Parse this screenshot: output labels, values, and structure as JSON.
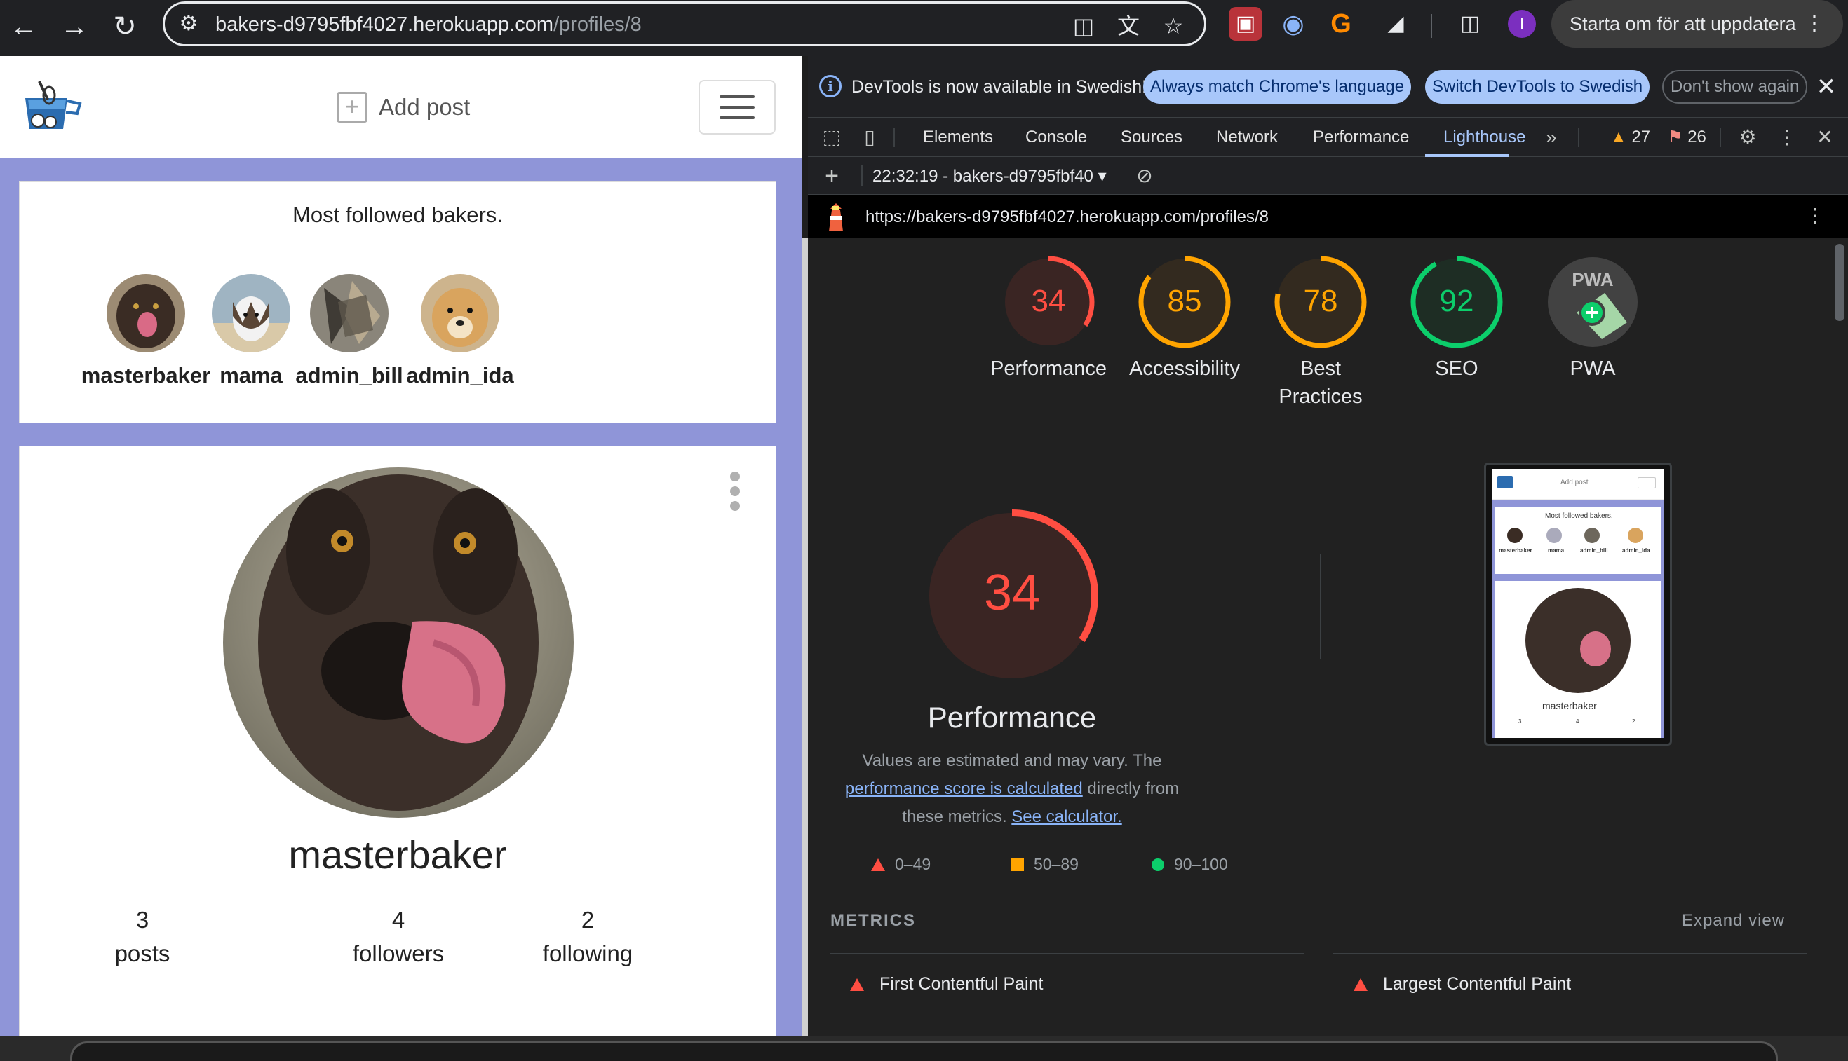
{
  "browser": {
    "url_host": "bakers-d9795fbf4027.herokuapp.com",
    "url_path": "/profiles/8",
    "update_button": "Starta om för att uppdatera",
    "profile_initial": "I"
  },
  "site": {
    "add_post": "Add post",
    "most_followed_title": "Most followed bakers.",
    "bakers": [
      {
        "name": "masterbaker"
      },
      {
        "name": "mama"
      },
      {
        "name": "admin_bill"
      },
      {
        "name": "admin_ida"
      }
    ],
    "profile": {
      "name": "masterbaker",
      "posts_count": "3",
      "posts_label": "posts",
      "followers_count": "4",
      "followers_label": "followers",
      "following_count": "2",
      "following_label": "following"
    }
  },
  "devtools": {
    "info_message": "DevTools is now available in Swedish!",
    "info_buttons": [
      "Always match Chrome's language",
      "Switch DevTools to Swedish",
      "Don't show again"
    ],
    "tabs": [
      "Elements",
      "Console",
      "Sources",
      "Network",
      "Performance",
      "Lighthouse"
    ],
    "active_tab": "Lighthouse",
    "warning_count": "27",
    "issue_count": "26",
    "report_selector": "22:32:19 - bakers-d9795fbf40",
    "report_url": "https://bakers-d9795fbf4027.herokuapp.com/profiles/8"
  },
  "lighthouse": {
    "scores": [
      {
        "label": "Performance",
        "value": "34",
        "score": 34,
        "status": "fail"
      },
      {
        "label": "Accessibility",
        "value": "85",
        "score": 85,
        "status": "average"
      },
      {
        "label": "Best Practices",
        "value": "78",
        "score": 78,
        "status": "average"
      },
      {
        "label": "SEO",
        "value": "92",
        "score": 92,
        "status": "pass"
      },
      {
        "label": "PWA",
        "value": "PWA",
        "score": null,
        "status": "na"
      }
    ],
    "main_score": "34",
    "main_title": "Performance",
    "desc_before": "Values are estimated and may vary. The ",
    "desc_link1": "performance score is calculated",
    "desc_middle": " directly from these metrics. ",
    "desc_link2": "See calculator.",
    "legend": [
      {
        "label": "0–49"
      },
      {
        "label": "50–89"
      },
      {
        "label": "90–100"
      }
    ],
    "metrics_heading": "METRICS",
    "expand_view": "Expand view",
    "metrics": [
      "First Contentful Paint",
      "Largest Contentful Paint"
    ],
    "thumb": {
      "add_post": "Add post",
      "title": "Most followed bakers.",
      "names": [
        "masterbaker",
        "mama",
        "admin_bill",
        "admin_ida"
      ],
      "profile_name": "masterbaker",
      "stats": [
        "3",
        "4",
        "2"
      ]
    }
  },
  "colors": {
    "fail": "#ff4e42",
    "average": "#ffa400",
    "pass": "#0cce6b",
    "site_bg": "#8f95d8",
    "link": "#8ab4f8"
  }
}
